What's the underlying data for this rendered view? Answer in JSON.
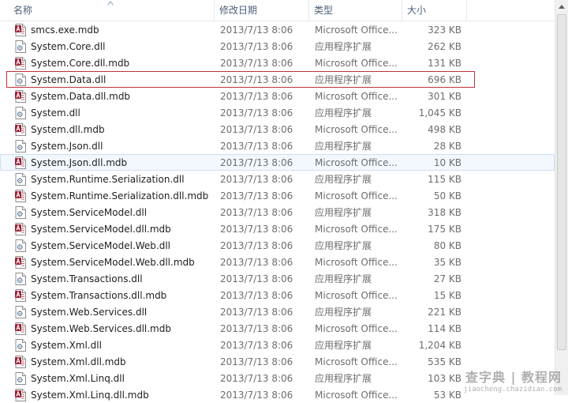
{
  "header": {
    "columns": {
      "name": "名称",
      "date": "修改日期",
      "type": "类型",
      "size": "大小"
    },
    "sort_icon": "sort-up-arrow-icon"
  },
  "colors": {
    "selection_outline": "#c0323a",
    "hover_background": "#f3f8ff",
    "header_text": "#4c607a"
  },
  "files": [
    {
      "name": "smcs.exe.mdb",
      "date": "2013/7/13 8:06",
      "type": "Microsoft Office...",
      "size": "323 KB",
      "icon": "access-file-icon"
    },
    {
      "name": "System.Core.dll",
      "date": "2013/7/13 8:06",
      "type": "应用程序扩展",
      "size": "262 KB",
      "icon": "dll-file-icon"
    },
    {
      "name": "System.Core.dll.mdb",
      "date": "2013/7/13 8:06",
      "type": "Microsoft Office...",
      "size": "131 KB",
      "icon": "access-file-icon"
    },
    {
      "name": "System.Data.dll",
      "date": "2013/7/13 8:06",
      "type": "应用程序扩展",
      "size": "696 KB",
      "icon": "dll-file-icon"
    },
    {
      "name": "System.Data.dll.mdb",
      "date": "2013/7/13 8:06",
      "type": "Microsoft Office...",
      "size": "301 KB",
      "icon": "access-file-icon"
    },
    {
      "name": "System.dll",
      "date": "2013/7/13 8:06",
      "type": "应用程序扩展",
      "size": "1,045 KB",
      "icon": "dll-file-icon"
    },
    {
      "name": "System.dll.mdb",
      "date": "2013/7/13 8:06",
      "type": "Microsoft Office...",
      "size": "498 KB",
      "icon": "access-file-icon"
    },
    {
      "name": "System.Json.dll",
      "date": "2013/7/13 8:06",
      "type": "应用程序扩展",
      "size": "28 KB",
      "icon": "dll-file-icon"
    },
    {
      "name": "System.Json.dll.mdb",
      "date": "2013/7/13 8:06",
      "type": "Microsoft Office...",
      "size": "10 KB",
      "icon": "access-file-icon"
    },
    {
      "name": "System.Runtime.Serialization.dll",
      "date": "2013/7/13 8:06",
      "type": "应用程序扩展",
      "size": "115 KB",
      "icon": "dll-file-icon"
    },
    {
      "name": "System.Runtime.Serialization.dll.mdb",
      "date": "2013/7/13 8:06",
      "type": "Microsoft Office...",
      "size": "50 KB",
      "icon": "access-file-icon"
    },
    {
      "name": "System.ServiceModel.dll",
      "date": "2013/7/13 8:06",
      "type": "应用程序扩展",
      "size": "318 KB",
      "icon": "dll-file-icon"
    },
    {
      "name": "System.ServiceModel.dll.mdb",
      "date": "2013/7/13 8:06",
      "type": "Microsoft Office...",
      "size": "175 KB",
      "icon": "access-file-icon"
    },
    {
      "name": "System.ServiceModel.Web.dll",
      "date": "2013/7/13 8:06",
      "type": "应用程序扩展",
      "size": "80 KB",
      "icon": "dll-file-icon"
    },
    {
      "name": "System.ServiceModel.Web.dll.mdb",
      "date": "2013/7/13 8:06",
      "type": "Microsoft Office...",
      "size": "35 KB",
      "icon": "access-file-icon"
    },
    {
      "name": "System.Transactions.dll",
      "date": "2013/7/13 8:06",
      "type": "应用程序扩展",
      "size": "27 KB",
      "icon": "dll-file-icon"
    },
    {
      "name": "System.Transactions.dll.mdb",
      "date": "2013/7/13 8:06",
      "type": "Microsoft Office...",
      "size": "15 KB",
      "icon": "access-file-icon"
    },
    {
      "name": "System.Web.Services.dll",
      "date": "2013/7/13 8:06",
      "type": "应用程序扩展",
      "size": "221 KB",
      "icon": "dll-file-icon"
    },
    {
      "name": "System.Web.Services.dll.mdb",
      "date": "2013/7/13 8:06",
      "type": "Microsoft Office...",
      "size": "114 KB",
      "icon": "access-file-icon"
    },
    {
      "name": "System.Xml.dll",
      "date": "2013/7/13 8:06",
      "type": "应用程序扩展",
      "size": "1,204 KB",
      "icon": "dll-file-icon"
    },
    {
      "name": "System.Xml.dll.mdb",
      "date": "2013/7/13 8:06",
      "type": "Microsoft Office...",
      "size": "535 KB",
      "icon": "access-file-icon"
    },
    {
      "name": "System.Xml.Linq.dll",
      "date": "2013/7/13 8:06",
      "type": "应用程序扩展",
      "size": "103 KB",
      "icon": "dll-file-icon"
    },
    {
      "name": "System.Xml.Linq.dll.mdb",
      "date": "2013/7/13 8:06",
      "type": "Microsoft Office...",
      "size": "53 KB",
      "icon": "access-file-icon"
    }
  ],
  "outlined_file": "System.Data.dll",
  "hovered_file": "System.Json.dll.mdb",
  "watermark": {
    "main": "查字典 | 教程网",
    "url": "jiaocheng.chazidian.com"
  }
}
